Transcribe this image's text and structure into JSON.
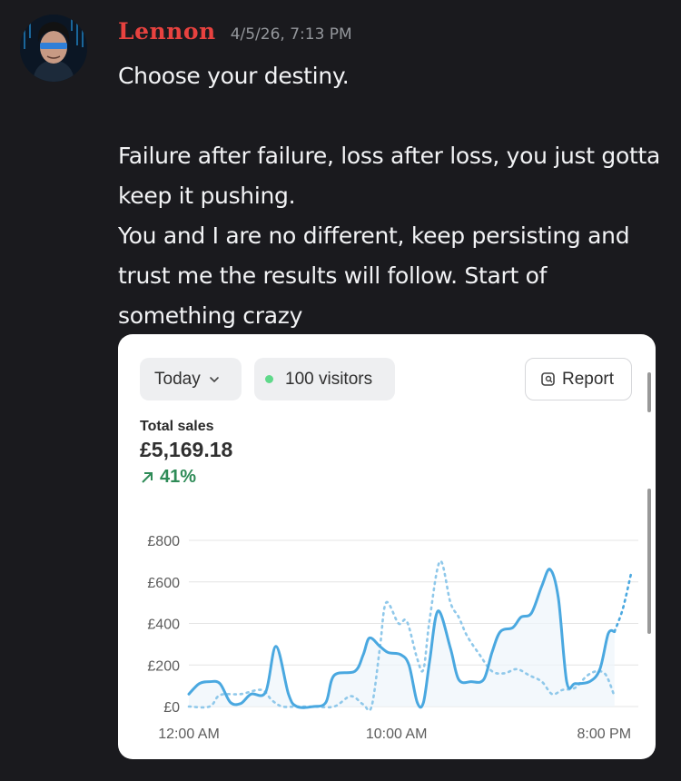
{
  "message": {
    "author": "Lennon",
    "timestamp": "4/5/26, 7:13 PM",
    "text": "Choose your destiny.\n\nFailure after failure, loss after loss, you just gotta keep it pushing.\nYou and I are no different, keep persisting and trust me the results will follow. Start of something crazy",
    "avatar_icon": "avatar-icon",
    "username_color": "#e8423f"
  },
  "card": {
    "period_label": "Today",
    "visitors_label": "100 visitors",
    "report_label": "Report",
    "total_sales_label": "Total sales",
    "total_sales_value": "£5,169.18",
    "change_label": "41%",
    "change_color": "#2e8b57"
  },
  "chart_data": {
    "type": "line",
    "ylim": [
      0,
      800
    ],
    "yticks": [
      "£800",
      "£600",
      "£400",
      "£200",
      "£0"
    ],
    "ytick_values": [
      800,
      600,
      400,
      200,
      0
    ],
    "xticks": [
      "12:00 AM",
      "10:00 AM",
      "8:00 PM"
    ],
    "xtick_hours": [
      0,
      10,
      20
    ],
    "grid": true,
    "series": [
      {
        "style": "solid",
        "color": "#4aa8e0",
        "points": [
          [
            0,
            60
          ],
          [
            0.5,
            110
          ],
          [
            1,
            120
          ],
          [
            1.5,
            110
          ],
          [
            2,
            20
          ],
          [
            2.5,
            15
          ],
          [
            3,
            60
          ],
          [
            3.7,
            70
          ],
          [
            4.2,
            290
          ],
          [
            4.8,
            60
          ],
          [
            5.2,
            0
          ],
          [
            6,
            0
          ],
          [
            6.6,
            20
          ],
          [
            7,
            150
          ],
          [
            8,
            170
          ],
          [
            8.4,
            250
          ],
          [
            8.7,
            330
          ],
          [
            9.2,
            290
          ],
          [
            9.6,
            260
          ],
          [
            10.2,
            250
          ],
          [
            10.6,
            200
          ],
          [
            11,
            20
          ],
          [
            11.3,
            20
          ],
          [
            11.6,
            220
          ],
          [
            12,
            460
          ],
          [
            12.6,
            280
          ],
          [
            13,
            130
          ],
          [
            13.6,
            120
          ],
          [
            14.2,
            130
          ],
          [
            14.6,
            260
          ],
          [
            15,
            360
          ],
          [
            15.6,
            380
          ],
          [
            16,
            430
          ],
          [
            16.5,
            450
          ],
          [
            17,
            580
          ],
          [
            17.4,
            660
          ],
          [
            17.8,
            520
          ],
          [
            18.2,
            120
          ],
          [
            18.6,
            110
          ],
          [
            19.3,
            120
          ],
          [
            19.8,
            180
          ],
          [
            20.2,
            350
          ],
          [
            20.5,
            360
          ]
        ]
      },
      {
        "style": "dotted",
        "color": "#8fc8ea",
        "points": [
          [
            0,
            0
          ],
          [
            1,
            0
          ],
          [
            1.5,
            55
          ],
          [
            2.5,
            60
          ],
          [
            3.5,
            80
          ],
          [
            4,
            30
          ],
          [
            4.5,
            0
          ],
          [
            5.2,
            0
          ],
          [
            6,
            0
          ],
          [
            7,
            0
          ],
          [
            7.8,
            50
          ],
          [
            8.4,
            10
          ],
          [
            8.8,
            0
          ],
          [
            9.2,
            280
          ],
          [
            9.5,
            500
          ],
          [
            10.1,
            400
          ],
          [
            10.5,
            410
          ],
          [
            11,
            230
          ],
          [
            11.3,
            180
          ],
          [
            11.6,
            420
          ],
          [
            12.1,
            700
          ],
          [
            12.6,
            500
          ],
          [
            13,
            430
          ],
          [
            13.4,
            340
          ],
          [
            14,
            250
          ],
          [
            14.6,
            170
          ],
          [
            15.2,
            160
          ],
          [
            15.8,
            180
          ],
          [
            16.4,
            150
          ],
          [
            17,
            120
          ],
          [
            17.5,
            60
          ],
          [
            18,
            80
          ],
          [
            18.6,
            90
          ],
          [
            19.2,
            150
          ],
          [
            19.7,
            170
          ],
          [
            20.1,
            150
          ],
          [
            20.5,
            50
          ]
        ]
      },
      {
        "style": "dotted",
        "color": "#4aa8e0",
        "points": [
          [
            20.5,
            360
          ],
          [
            20.9,
            470
          ],
          [
            21.3,
            640
          ]
        ]
      }
    ]
  }
}
